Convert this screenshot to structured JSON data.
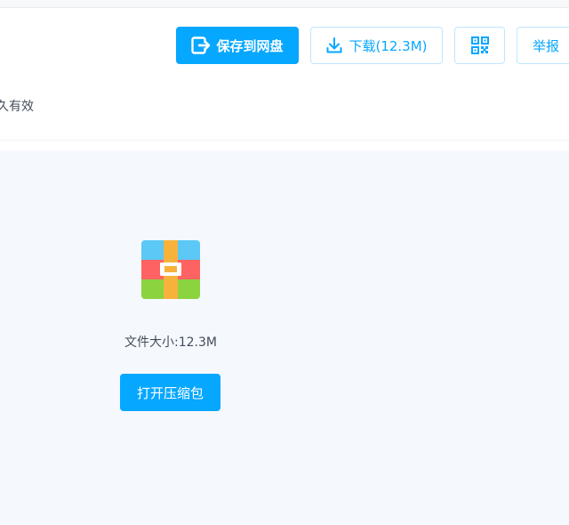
{
  "header": {
    "save_button": "保存到网盘",
    "download_button": "下载(12.3M)",
    "report_button": "举报",
    "validity_text": "久有效"
  },
  "file": {
    "size_text": "文件大小:12.3M",
    "open_button": "打开压缩包"
  },
  "colors": {
    "accent": "#06a7ff",
    "panel_bg": "#f5f8fd",
    "text": "#454d5a"
  },
  "icons": [
    "save-to-disk-icon",
    "download-icon",
    "qr-code-icon",
    "zip-archive-icon"
  ]
}
